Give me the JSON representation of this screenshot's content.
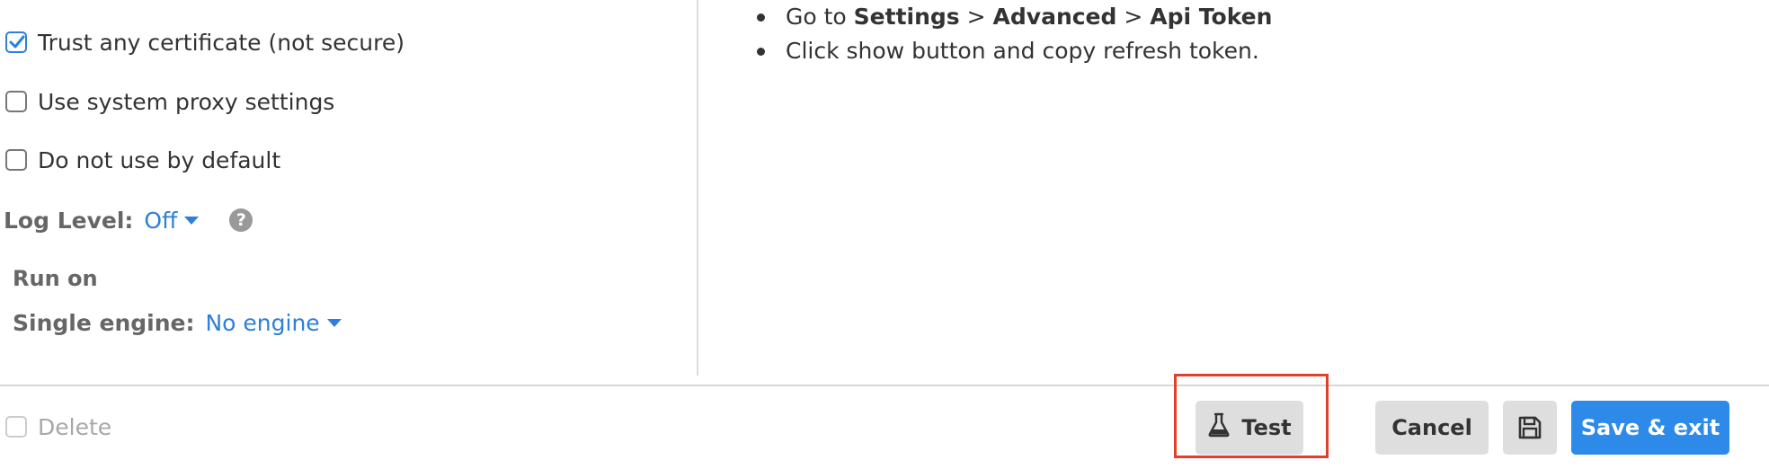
{
  "options": {
    "trust_certificate": {
      "label": "Trust any certificate (not secure)",
      "checked": true
    },
    "system_proxy": {
      "label": "Use system proxy settings",
      "checked": false
    },
    "not_default": {
      "label": "Do not use by default",
      "checked": false
    }
  },
  "log_level": {
    "label": "Log Level:",
    "value": "Off",
    "help_icon": "question-circle-icon"
  },
  "run_on": {
    "heading": "Run on",
    "single_engine_label": "Single engine:",
    "single_engine_value": "No engine"
  },
  "instructions": {
    "step1": {
      "prefix": "Go to ",
      "settings": "Settings",
      "sep1": " > ",
      "advanced": "Advanced",
      "sep2": " > ",
      "api_token": "Api Token"
    },
    "step2": "Click show button and copy refresh token."
  },
  "footer": {
    "delete_label": "Delete",
    "test_label": "Test",
    "cancel_label": "Cancel",
    "save_icon": "floppy-disk-icon",
    "save_exit_label": "Save & exit"
  },
  "colors": {
    "accent": "#2d7fd9",
    "primary_button": "#2d8ae8",
    "secondary_button": "#dedede",
    "highlight": "#e0412e"
  }
}
